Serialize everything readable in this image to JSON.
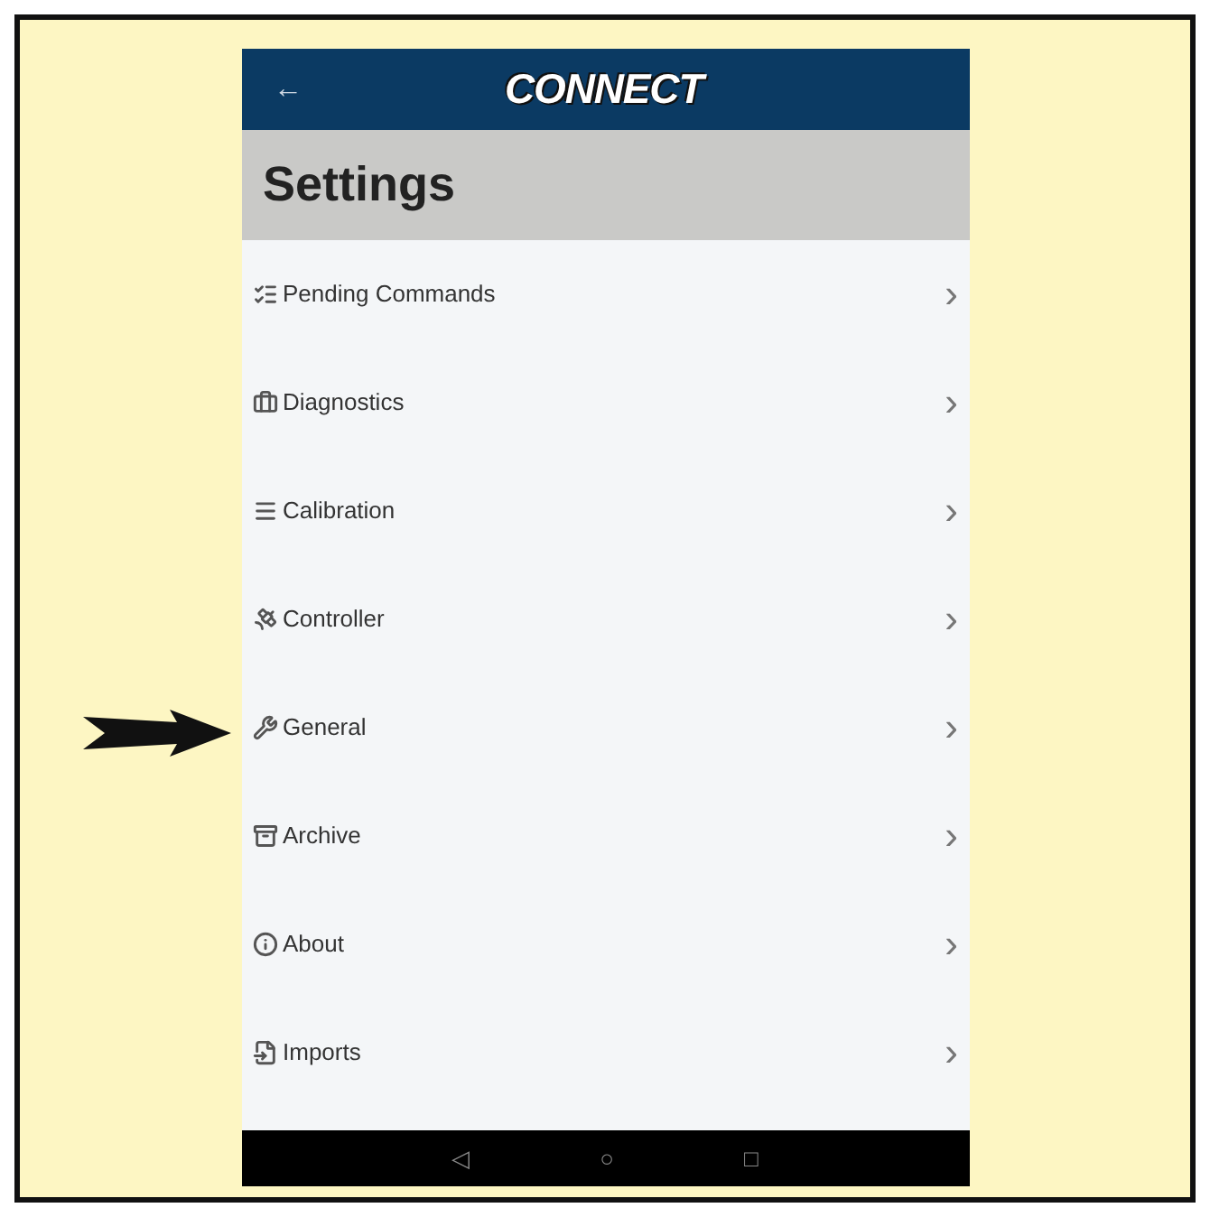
{
  "app_bar": {
    "back": "←",
    "logo": "CONNECT"
  },
  "page_title": "Settings",
  "items": [
    {
      "label": "Pending Commands",
      "chevron": "›",
      "pointed": false
    },
    {
      "label": "Diagnostics",
      "chevron": "›",
      "pointed": false
    },
    {
      "label": "Calibration",
      "chevron": "›",
      "pointed": false
    },
    {
      "label": "Controller",
      "chevron": "›",
      "pointed": false
    },
    {
      "label": "General",
      "chevron": "›",
      "pointed": true
    },
    {
      "label": "Archive",
      "chevron": "›",
      "pointed": false
    },
    {
      "label": "About",
      "chevron": "›",
      "pointed": false
    },
    {
      "label": "Imports",
      "chevron": "›",
      "pointed": false
    }
  ],
  "nav_bar": {
    "back": "◁",
    "home": "○",
    "recents": "□"
  }
}
